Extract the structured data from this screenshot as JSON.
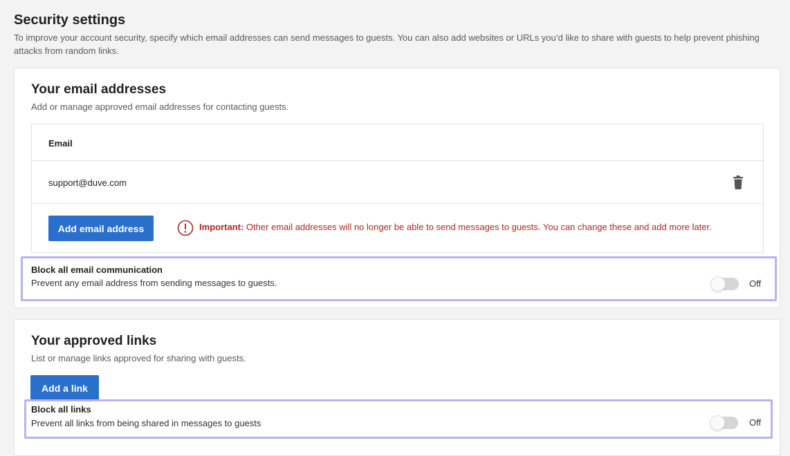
{
  "page": {
    "title": "Security settings",
    "description": "To improve your account security, specify which email addresses can send messages to guests. You can also add websites or URLs you’d like to share with guests to help prevent phishing attacks from random links."
  },
  "email_section": {
    "title": "Your email addresses",
    "description": "Add or manage approved email addresses for contacting guests.",
    "table": {
      "column_header": "Email",
      "rows": [
        {
          "email": "support@duve.com"
        }
      ]
    },
    "add_button_label": "Add email address",
    "warning": {
      "label": "Important:",
      "text": " Other email addresses will no longer be able to send messages to guests. You can change these and add more later."
    },
    "block": {
      "title": "Block all email communication",
      "description": "Prevent any email address from sending messages to guests.",
      "toggle_state": "Off"
    }
  },
  "links_section": {
    "title": "Your approved links",
    "description": "List or manage links approved for sharing with guests.",
    "add_button_label": "Add a link",
    "block": {
      "title": "Block all links",
      "description": "Prevent all links from being shared in messages to guests",
      "toggle_state": "Off"
    }
  },
  "colors": {
    "primary": "#2a6fcc",
    "warning": "#b3261e",
    "highlight_border": "#b6b3ef"
  },
  "icons": {
    "delete": "trash-icon",
    "warning": "warning-circle-icon"
  }
}
